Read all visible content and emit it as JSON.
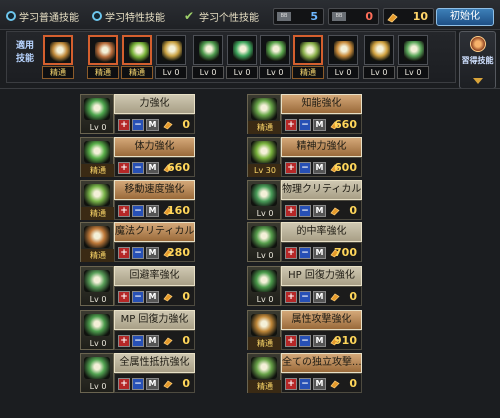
{
  "tabs": [
    {
      "label": "学习普通技能",
      "type": "radio"
    },
    {
      "label": "学习特性技能",
      "type": "radio"
    },
    {
      "label": "学习个性技能",
      "type": "check"
    }
  ],
  "stats": [
    {
      "tag": "BB",
      "value": "5",
      "color": "blue"
    },
    {
      "tag": "BB",
      "value": "0",
      "color": "red"
    },
    {
      "tag": "coin",
      "value": "10",
      "color": "gold"
    }
  ],
  "init_button": "初始化",
  "strip_label": "適用技能",
  "learn_button": "習得技能",
  "skill_strip": [
    {
      "label": "精通",
      "selected": true,
      "color": "#c08a3a"
    },
    {
      "label": "精通",
      "selected": true,
      "color": "#b56b3a"
    },
    {
      "label": "精通",
      "selected": true,
      "color": "#7ab53a"
    },
    {
      "label": "Lv 0",
      "selected": false,
      "color": "#c9a244"
    },
    {
      "label": "Lv 0",
      "selected": false,
      "color": "#4e9a4e"
    },
    {
      "label": "Lv 0",
      "selected": false,
      "color": "#3fa65e"
    },
    {
      "label": "Lv 0",
      "selected": false,
      "color": "#58a24a"
    },
    {
      "label": "精通",
      "selected": true,
      "color": "#8ab04a"
    },
    {
      "label": "Lv 0",
      "selected": false,
      "color": "#c78a3a"
    },
    {
      "label": "Lv 0",
      "selected": false,
      "color": "#d0a240"
    },
    {
      "label": "Lv 0",
      "selected": false,
      "color": "#5aa65a"
    }
  ],
  "left_cards": [
    {
      "name": "力強化",
      "level": "Lv 0",
      "cost": "0",
      "mastered": false,
      "color": "#4ea64e"
    },
    {
      "name": "体力強化",
      "level": "精通",
      "cost": "660",
      "mastered": true,
      "color": "#5ab04a"
    },
    {
      "name": "移動速度強化",
      "level": "精通",
      "cost": "160",
      "mastered": true,
      "color": "#7ab54a"
    },
    {
      "name": "魔法クリティカル...",
      "level": "精通",
      "cost": "280",
      "mastered": true,
      "color": "#c07a3a"
    },
    {
      "name": "回避率強化",
      "level": "Lv 0",
      "cost": "0",
      "mastered": false,
      "color": "#5aa05a"
    },
    {
      "name": "MP 回復力強化",
      "level": "Lv 0",
      "cost": "0",
      "mastered": false,
      "color": "#4e9e4e"
    },
    {
      "name": "全属性抵抗強化",
      "level": "Lv 0",
      "cost": "0",
      "mastered": false,
      "color": "#52a452"
    }
  ],
  "right_cards": [
    {
      "name": "知能強化",
      "level": "精通",
      "cost": "660",
      "mastered": true,
      "color": "#6aa84a"
    },
    {
      "name": "精神力強化",
      "level": "Lv 30",
      "cost": "600",
      "mastered": true,
      "color": "#7ab43e"
    },
    {
      "name": "物理クリティカル...",
      "level": "Lv 0",
      "cost": "0",
      "mastered": false,
      "color": "#4a9e5a"
    },
    {
      "name": "的中率強化",
      "level": "Lv 0",
      "cost": "700",
      "mastered": false,
      "color": "#58a04e"
    },
    {
      "name": "HP 回復力強化",
      "level": "Lv 0",
      "cost": "0",
      "mastered": false,
      "color": "#4c9c4c"
    },
    {
      "name": "属性攻撃強化",
      "level": "精通",
      "cost": "910",
      "mastered": true,
      "color": "#c0883a"
    },
    {
      "name": "全ての独立攻撃...",
      "level": "精通",
      "cost": "0",
      "mastered": true,
      "color": "#6aa44a"
    }
  ]
}
